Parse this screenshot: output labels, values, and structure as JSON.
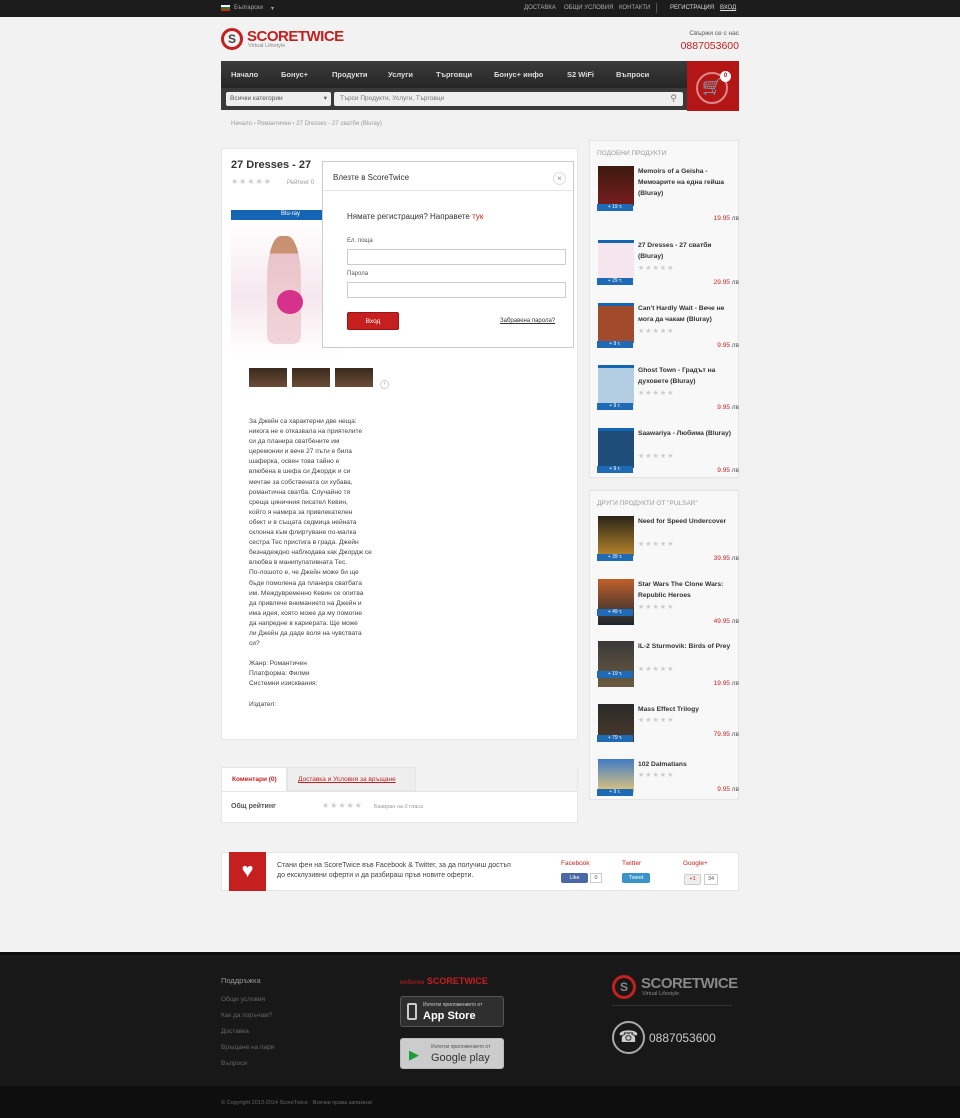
{
  "topbar": {
    "language": "Български",
    "links": [
      "ДОСТАВКА",
      "ОБЩИ УСЛОВИЯ",
      "КОНТАКТИ"
    ],
    "register": "РЕГИСТРАЦИЯ",
    "login": "ВХОД"
  },
  "header": {
    "logo_main": "SCORETWICE",
    "logo_sub": "Virtual Lifestyle",
    "contact_label": "Свържи се с нас",
    "phone": "0887053600"
  },
  "nav": [
    "Начало",
    "Бонус+",
    "Продукти",
    "Услуги",
    "Търговци",
    "Бонус+ инфо",
    "S2 WiFi",
    "Въпроси"
  ],
  "cart": {
    "count": "0"
  },
  "search": {
    "category": "Всички категории",
    "placeholder": "Търси Продукти, Услуги, Търговци"
  },
  "breadcrumb": "Начало › Романтичен › 27 Dresses - 27 сватби (Bluray)",
  "product": {
    "title": "27 Dresses - 27",
    "rating_label": "Рейтинг 0",
    "description": "За Джейн са характерни две неща:\nникога не е отказвала на приятелите\nси да планира сватбените им\nцеремонии и вече 27 пъти е била\nшаферка, освен това тайно е\nвлюбена в шефа си Джордж и си\nмечтае за собствената си хубава,\nромантична сватба. Случайно тя\nсреща циничния писател Кевин,\nкойто я намира за привлекателен\nобект и в същата седмица нейната\nсклонна към флиртуване по-малка\nсестра Тес пристига в града. Джейн\nбезнадеждно наблюдава как Джордж се\nвлюбва в манипулативната Тес.\nПо-лошото е, че Джейн може би ще\nбъде помолена да планира сватбата\nим. Междувременно Кевин се опитва\nда привлече вниманието на Джейн и\nима идея, която може да му помогне\nда напредне в кариерата. Ще може\nли Джейн да даде воля на чувствата\nси?\n\nЖанр: Романтичен\nПлатформа: Филми\nСистемни изисквания:\n\nИздател:"
  },
  "modal": {
    "title": "Влезте в ScoreTwice",
    "close": "×",
    "prompt": "Нямате регистрация? Направете ",
    "prompt_link": "тук",
    "email_label": "Ел. поща",
    "password_label": "Парола",
    "submit": "Вход",
    "forgot": "Забравена парола?"
  },
  "tabs": {
    "comments": "Коментари (0)",
    "delivery": "Доставка и Условия за връщане",
    "overall": "Общ рейтинг",
    "votes": "Базиран на 0 гласа"
  },
  "sidebar": {
    "similar_title": "ПОДОБНИ ПРОДУКТИ",
    "similar": [
      {
        "name": "Memoirs of a Geisha - Мемоарите на една гейша (Bluray)",
        "badge": "+ 19 т.",
        "price": "19.95",
        "unit": "лв"
      },
      {
        "name": "27 Dresses - 27 сватби (Bluray)",
        "badge": "+ 29 т.",
        "price": "29.95",
        "unit": "лв"
      },
      {
        "name": "Can't Hardly Wait - Вече не мога да чакам (Bluray)",
        "badge": "+ 9 т.",
        "price": "9.95",
        "unit": "лв"
      },
      {
        "name": "Ghost Town - Градът на духовете (Bluray)",
        "badge": "+ 9 т.",
        "price": "9.95",
        "unit": "лв"
      },
      {
        "name": "Saawariya - Любима (Bluray)",
        "badge": "+ 9 т.",
        "price": "9.95",
        "unit": "лв"
      }
    ],
    "others_title": "ДРУГИ ПРОДУКТИ ОТ \"PULSAR\"",
    "others": [
      {
        "name": "Need for Speed Undercover",
        "badge": "+ 39 т.",
        "price": "39.95",
        "unit": "лв"
      },
      {
        "name": "Star Wars The Clone Wars: Republic Heroes",
        "badge": "+ 49 т.",
        "price": "49.95",
        "unit": "лв"
      },
      {
        "name": "IL-2 Sturmovik: Birds of Prey",
        "badge": "+ 19 т.",
        "price": "19.95",
        "unit": "лв"
      },
      {
        "name": "Mass Effect Trilogy",
        "badge": "+ 79 т.",
        "price": "79.95",
        "unit": "лв"
      },
      {
        "name": "102 Dalmatians",
        "badge": "+ 9 т.",
        "price": "9.95",
        "unit": "лв"
      }
    ]
  },
  "social": {
    "text1": "Стани фен на ",
    "brand": "ScoreTwice",
    "text2": " във Facebook & Twitter, за да получиш достъп",
    "text3": "до ексклузивни оферти и да разбираш пръв новите оферти.",
    "facebook": "Facebook",
    "like": "Like",
    "like_count": "0",
    "twitter": "Twitter",
    "tweet": "Tweet",
    "google": "Google+",
    "gplus": "+1",
    "gcount": "34"
  },
  "footer": {
    "support_title": "Поддръжка",
    "links": [
      "Общи условия",
      "Как да поръчам?",
      "Доставка",
      "Връщане на пари",
      "Въпроси"
    ],
    "mobile_prefix": "мобилен",
    "mobile_brand": "SCORETWICE",
    "appstore_small": "Изтегли приложението от",
    "appstore": "App Store",
    "gplay_small": "Изтегли приложението от",
    "gplay": "Google play",
    "phone": "0887053600",
    "copyright": "© Copyright 2013-2014 ScoreTwice · Всички права запазени"
  }
}
